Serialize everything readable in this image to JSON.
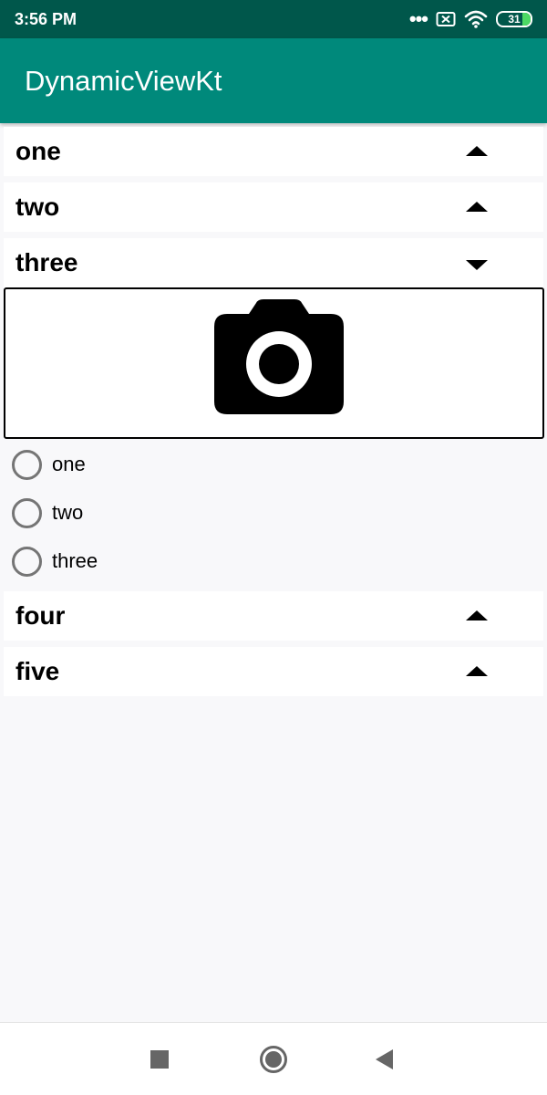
{
  "status_bar": {
    "time": "3:56 PM",
    "more": "•••",
    "battery": "31",
    "icons": [
      "more-icon",
      "no-sim-icon",
      "wifi-icon",
      "battery-icon"
    ],
    "color": "#00574b"
  },
  "app_bar": {
    "title": "DynamicViewKt",
    "color": "#00897b"
  },
  "sections": [
    {
      "title": "one",
      "expanded": false
    },
    {
      "title": "two",
      "expanded": false
    },
    {
      "title": "three",
      "expanded": true
    },
    {
      "title": "four",
      "expanded": false
    },
    {
      "title": "five",
      "expanded": false
    }
  ],
  "expanded_content": {
    "image_icon": "camera-icon",
    "radio_options": [
      {
        "label": "one",
        "checked": false
      },
      {
        "label": "two",
        "checked": false
      },
      {
        "label": "three",
        "checked": false
      }
    ]
  },
  "nav_bar": {
    "icons": [
      "recents-icon",
      "home-icon",
      "back-icon"
    ]
  }
}
